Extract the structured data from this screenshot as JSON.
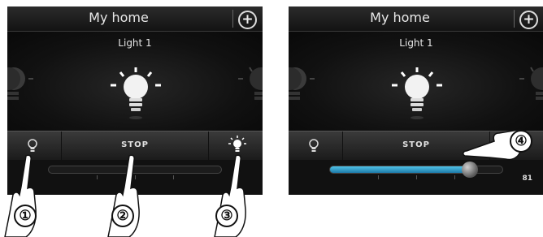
{
  "screens": [
    {
      "header": {
        "title": "My home"
      },
      "device": {
        "name": "Light 1"
      },
      "controls": {
        "stop_label": "STOP"
      }
    },
    {
      "header": {
        "title": "My home"
      },
      "device": {
        "name": "Light 1"
      },
      "controls": {
        "stop_label": "STOP"
      },
      "slider": {
        "value": "81",
        "level": 0.81
      }
    }
  ],
  "callouts": [
    "①",
    "②",
    "③",
    "④"
  ],
  "colors": {
    "slider_fill": "#2a9fd0",
    "screen_bg": "#0e0e0e"
  },
  "icons": [
    "add-icon",
    "bulb-off-icon",
    "bulb-on-icon",
    "light-bulb-icon"
  ]
}
